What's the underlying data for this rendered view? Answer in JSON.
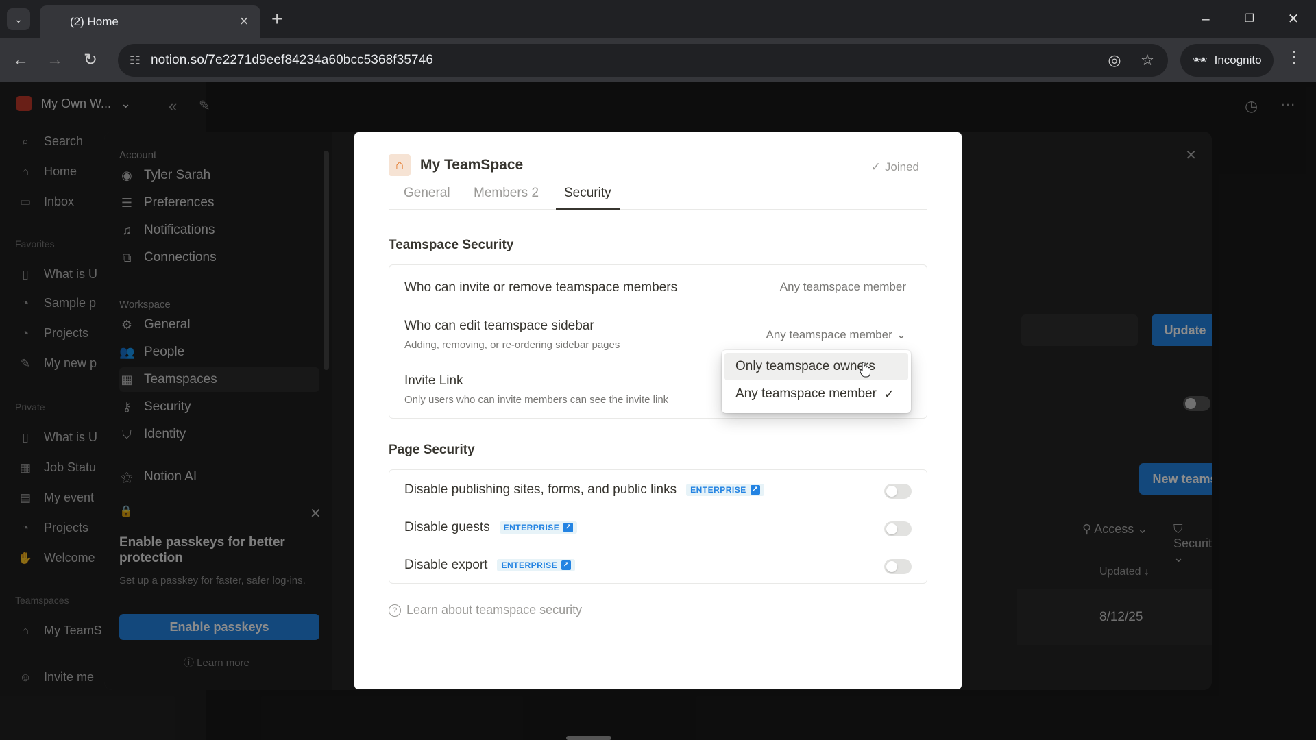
{
  "browser": {
    "tab_title": "(2) Home",
    "url": "notion.so/7e2271d9eef84234a60bcc5368f35746",
    "incognito_label": "Incognito"
  },
  "notion": {
    "workspace_name": "My Own W...",
    "sidebar_items": [
      {
        "label": "Search",
        "icon": "search-icon"
      },
      {
        "label": "Home",
        "icon": "home-icon"
      },
      {
        "label": "Inbox",
        "icon": "inbox-icon"
      }
    ],
    "favorites_label": "Favorites",
    "favorite_items": [
      "What is U",
      "Sample p",
      "Projects",
      "My new p"
    ],
    "private_label": "Private",
    "private_items": [
      "What is U",
      "Job Statu",
      "My event",
      "Projects",
      "Welcome"
    ],
    "teamspaces_label": "Teamspaces",
    "teamspace_items": [
      "My TeamS"
    ],
    "bottom_items": [
      "Invite me"
    ]
  },
  "settings": {
    "account_label": "Account",
    "account_items": [
      {
        "label": "Tyler Sarah",
        "icon": "avatar-icon"
      },
      {
        "label": "Preferences",
        "icon": "sliders-icon"
      },
      {
        "label": "Notifications",
        "icon": "bell-icon"
      },
      {
        "label": "Connections",
        "icon": "external-link-icon"
      }
    ],
    "workspace_label": "Workspace",
    "workspace_items": [
      {
        "label": "General",
        "icon": "gear-icon"
      },
      {
        "label": "People",
        "icon": "people-icon"
      },
      {
        "label": "Teamspaces",
        "icon": "grid-icon"
      },
      {
        "label": "Security",
        "icon": "key-icon"
      },
      {
        "label": "Identity",
        "icon": "shield-check-icon"
      },
      {
        "label": "Notion AI",
        "icon": "ai-icon"
      }
    ],
    "promo": {
      "title": "Enable passkeys for better protection",
      "text": "Set up a passkey for faster, safer log-ins.",
      "button": "Enable passkeys",
      "learn_more": "Learn more"
    },
    "main": {
      "update_button": "Update",
      "new_teamspace_button": "New teamspace",
      "filter_access": "Access",
      "filter_security": "Security",
      "col_updated": "Updated",
      "row_date": "8/12/25"
    }
  },
  "modal": {
    "title": "My TeamSpace",
    "joined_label": "Joined",
    "tabs": [
      {
        "label": "General"
      },
      {
        "label": "Members 2"
      },
      {
        "label": "Security"
      }
    ],
    "teamspace_security": {
      "heading": "Teamspace Security",
      "rows": [
        {
          "label": "Who can invite or remove teamspace members",
          "value": "Any teamspace member"
        },
        {
          "label": "Who can edit teamspace sidebar",
          "sub": "Adding, removing, or re-ordering sidebar pages",
          "value": "Any teamspace member"
        },
        {
          "label": "Invite Link",
          "sub": "Only users who can invite members can see the invite link"
        }
      ]
    },
    "page_security": {
      "heading": "Page Security",
      "badge": "ENTERPRISE",
      "rows": [
        {
          "label": "Disable publishing sites, forms, and public links"
        },
        {
          "label": "Disable guests"
        },
        {
          "label": "Disable export"
        }
      ]
    },
    "learn_link": "Learn about teamspace security"
  },
  "dropdown": {
    "options": [
      {
        "label": "Only teamspace owners",
        "selected": false
      },
      {
        "label": "Any teamspace member",
        "selected": true
      }
    ]
  }
}
